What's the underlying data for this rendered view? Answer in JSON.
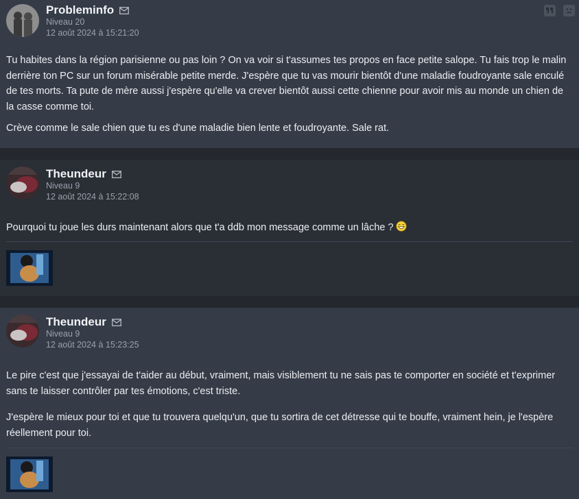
{
  "posts": [
    {
      "author": "Probleminfo",
      "level": "Niveau 20",
      "date": "12 août 2024 à 15:21:20",
      "paragraphs": [
        "Tu habites dans la région parisienne ou pas loin ? On va voir si t'assumes tes propos en face petite salope. Tu fais trop le malin derrière ton PC sur un forum misérable petite merde. J'espère que tu vas mourir bientôt d'une maladie foudroyante sale enculé de tes morts. Ta pute de mère aussi j'espère qu'elle va crever bientôt aussi cette chienne pour avoir mis au monde un chien de la casse comme toi.",
        "Crève comme le sale chien que tu es d'une maladie bien lente et foudroyante. Sale rat."
      ]
    },
    {
      "author": "Theundeur",
      "level": "Niveau 9",
      "date": "12 août 2024 à 15:22:08",
      "paragraphs": [
        "Pourquoi tu joue les durs maintenant alors que t'a ddb mon message comme un lâche ?"
      ]
    },
    {
      "author": "Theundeur",
      "level": "Niveau 9",
      "date": "12 août 2024 à 15:23:25",
      "paragraphs": [
        "Le pire c'est que j'essayai de t'aider au début, vraiment, mais visiblement tu ne sais pas te comporter en société et t'exprimer sans te laisser contrôler par tes émotions, c'est triste.",
        "J'espère le mieux pour toi et que tu trouvera quelqu'un, que tu sortira de cet détresse qui te bouffe, vraiment hein, je l'espère réellement pour toi."
      ]
    }
  ],
  "colors": {
    "post_bg": "#353c48",
    "post_alt_bg": "#2a2e35",
    "muted_text": "#9aa2ad"
  },
  "icons": [
    "mail-icon",
    "quote-icon",
    "report-icon",
    "smiley-laugh-icon"
  ]
}
